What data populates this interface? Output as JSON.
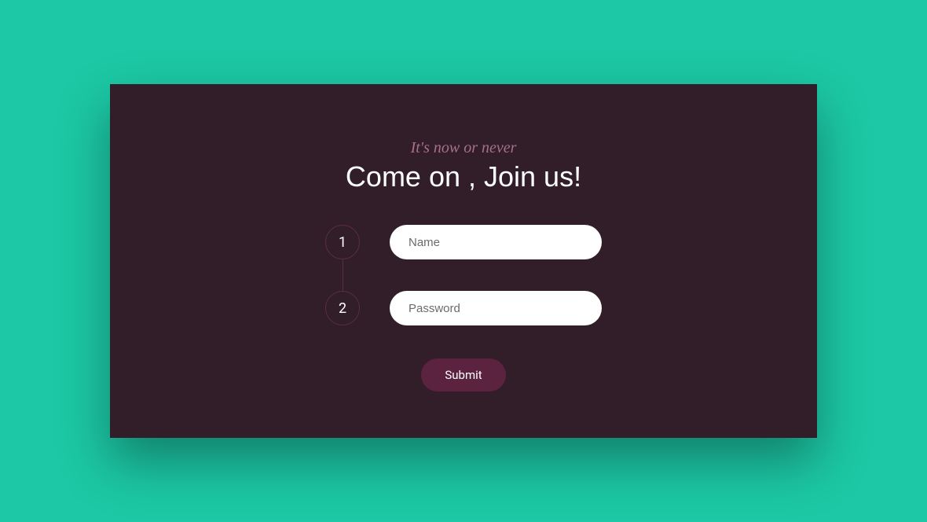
{
  "header": {
    "subtitle": "It's now or never",
    "title": "Come on , Join us!"
  },
  "form": {
    "steps": [
      {
        "number": "1",
        "placeholder": "Name"
      },
      {
        "number": "2",
        "placeholder": "Password"
      }
    ],
    "submit_label": "Submit"
  }
}
